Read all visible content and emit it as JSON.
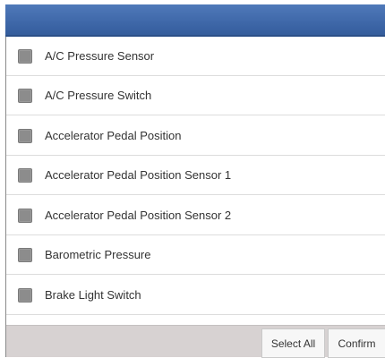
{
  "header": {
    "color": "#3f68a9"
  },
  "list": {
    "items": [
      {
        "label": "A/C Pressure Sensor",
        "checked": false
      },
      {
        "label": "A/C Pressure Switch",
        "checked": false
      },
      {
        "label": "Accelerator Pedal Position",
        "checked": false
      },
      {
        "label": "Accelerator Pedal Position Sensor 1",
        "checked": false
      },
      {
        "label": "Accelerator Pedal Position Sensor 2",
        "checked": false
      },
      {
        "label": "Barometric Pressure",
        "checked": false
      },
      {
        "label": "Brake Light Switch",
        "checked": false
      }
    ]
  },
  "footer": {
    "select_all_label": "Select All",
    "confirm_label": "Confirm"
  }
}
